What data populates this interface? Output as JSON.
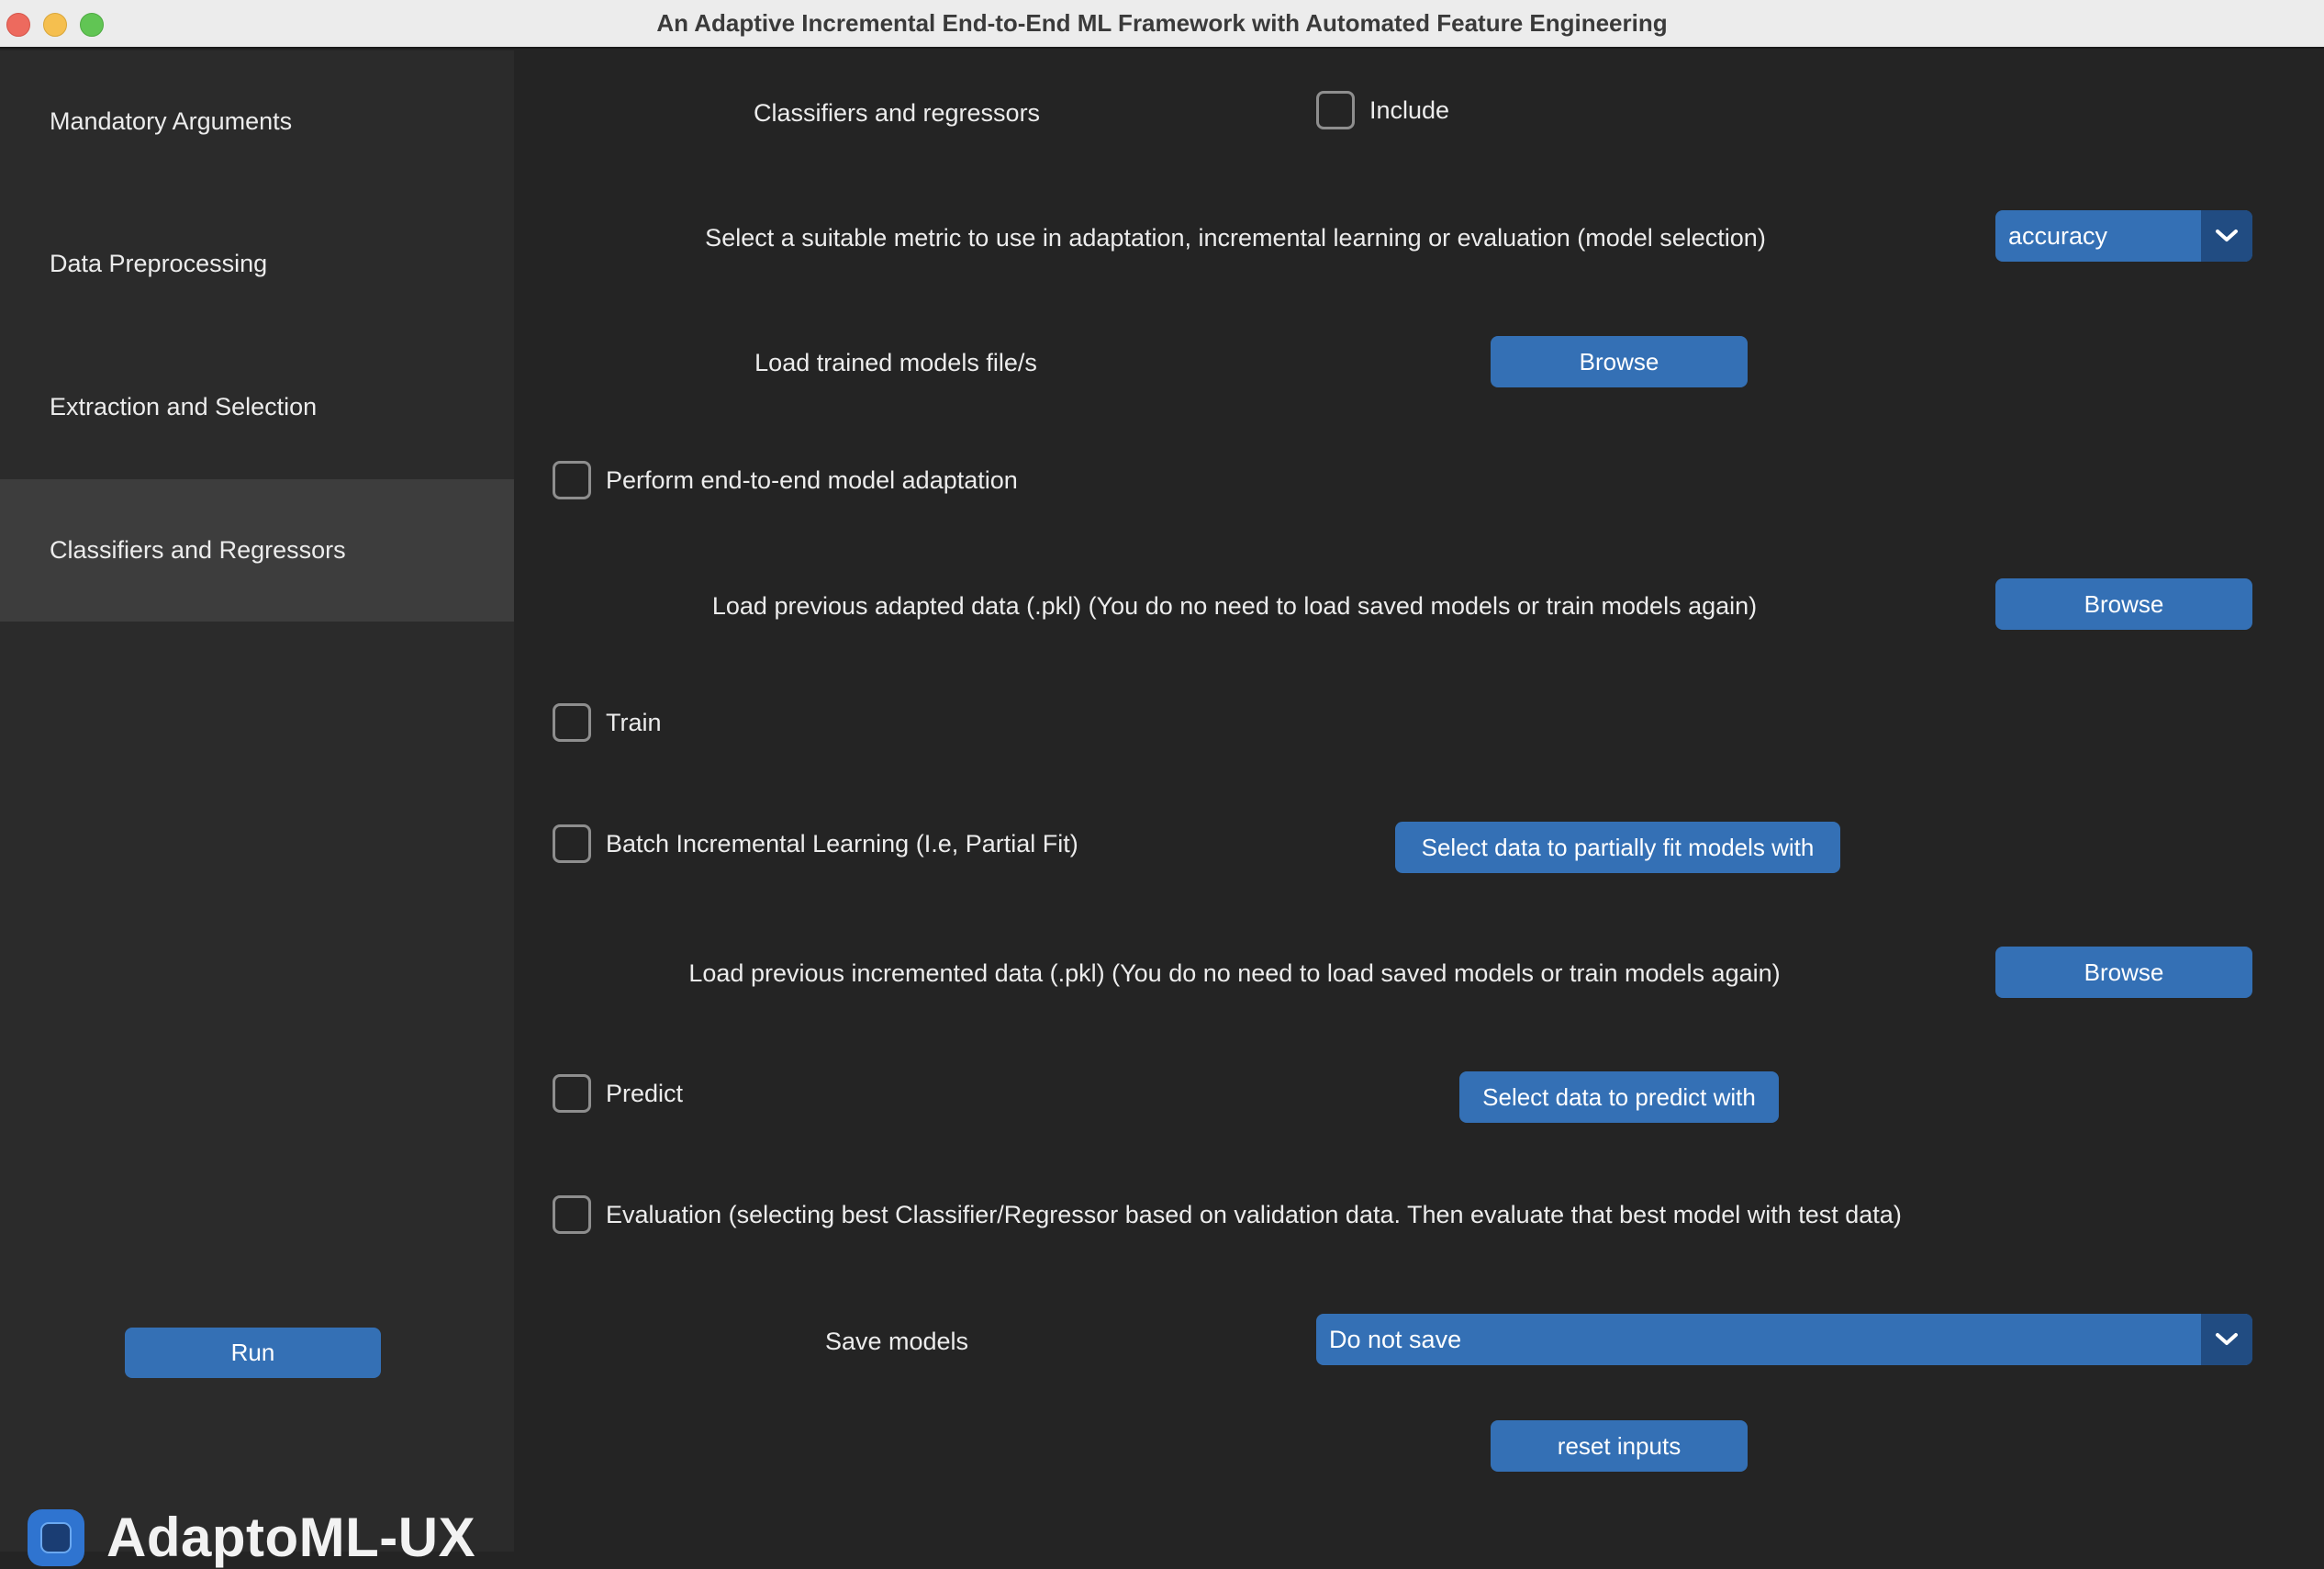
{
  "window": {
    "title": "An Adaptive Incremental End-to-End ML Framework with Automated Feature Engineering"
  },
  "sidebar": {
    "items": [
      {
        "label": "Mandatory Arguments",
        "active": false
      },
      {
        "label": "Data Preprocessing",
        "active": false
      },
      {
        "label": "Extraction and Selection",
        "active": false
      },
      {
        "label": "Classifiers and Regressors",
        "active": true
      }
    ],
    "run_label": "Run",
    "brand_name": "AdaptoML-UX"
  },
  "main": {
    "section_label": "Classifiers and regressors",
    "include_label": "Include",
    "metric_label": "Select a suitable metric to use in adaptation, incremental learning or evaluation (model selection)",
    "metric_value": "accuracy",
    "load_models_label": "Load trained models file/s",
    "browse_label": "Browse",
    "adaptation_label": "Perform end-to-end model adaptation",
    "load_adapted_label": "Load previous adapted data (.pkl) (You do no need to load saved models or train models again)",
    "train_label": "Train",
    "batch_label": "Batch Incremental Learning (I.e, Partial Fit)",
    "partial_fit_button": "Select data to partially fit models with",
    "load_incremented_label": "Load previous incremented data (.pkl) (You do no need to load saved models or train models again)",
    "predict_label": "Predict",
    "predict_button": "Select data to predict with",
    "evaluation_label": "Evaluation (selecting best Classifier/Regressor based on validation data. Then evaluate that best model with test data)",
    "save_models_label": "Save models",
    "save_models_value": "Do not save",
    "reset_label": "reset inputs"
  },
  "colors": {
    "accent": "#3470b5",
    "accent_dark": "#214c82",
    "sidebar_bg": "#2b2b2b",
    "active_item_bg": "#3d3d3d",
    "main_bg": "#242424"
  },
  "icons": {
    "dropdown": "chevron-down-icon",
    "brand": "app-logo-icon"
  }
}
